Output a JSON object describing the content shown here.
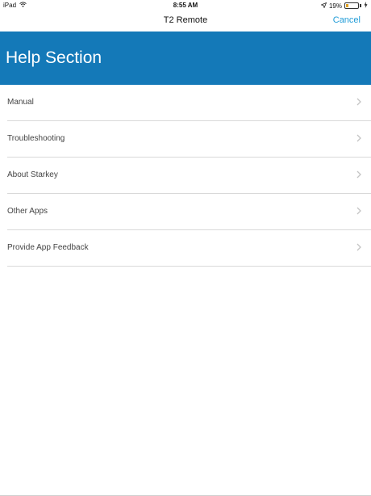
{
  "status_bar": {
    "device": "iPad",
    "time": "8:55 AM",
    "battery_percent": "19%",
    "battery_level": 0.19,
    "wifi_icon": "wifi-icon",
    "location_icon": "location-arrow-icon",
    "charging_icon": "charging-bolt-icon"
  },
  "nav": {
    "title": "T2 Remote",
    "cancel_label": "Cancel",
    "accent_color": "#1e9bd7"
  },
  "header": {
    "title": "Help Section",
    "background_color": "#1479b8"
  },
  "menu": {
    "items": [
      {
        "label": "Manual"
      },
      {
        "label": "Troubleshooting"
      },
      {
        "label": "About Starkey"
      },
      {
        "label": "Other Apps"
      },
      {
        "label": "Provide App Feedback"
      }
    ],
    "chevron_icon": "chevron-right-icon"
  }
}
